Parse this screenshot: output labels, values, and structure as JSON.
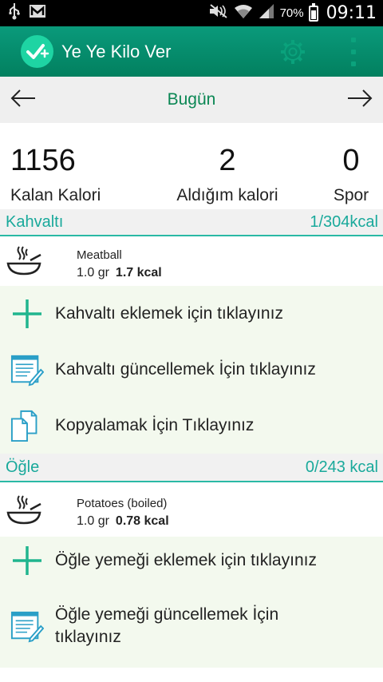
{
  "status_bar": {
    "battery_percent": "70%",
    "time": "09:11"
  },
  "app_bar": {
    "title": "Ye Ye Kilo Ver"
  },
  "date_nav": {
    "title": "Bugün"
  },
  "summary": {
    "remaining": {
      "value": "1156",
      "label": "Kalan Kalori"
    },
    "consumed": {
      "value": "2",
      "label": "Aldığım kalori"
    },
    "sport": {
      "value": "0",
      "label": "Spor"
    }
  },
  "meals": [
    {
      "name": "Kahvaltı",
      "calories": "1/304kcal",
      "food": {
        "name": "Meatball",
        "amount": "1.0 gr",
        "kcal": "1.7 kcal"
      },
      "add_label": "Kahvaltı eklemek için tıklayınız",
      "update_label": "Kahvaltı güncellemek İçin tıklayınız",
      "copy_label": "Kopyalamak İçin Tıklayınız"
    },
    {
      "name": "Öğle",
      "calories": "0/243 kcal",
      "food": {
        "name": "Potatoes (boiled)",
        "amount": "1.0 gr",
        "kcal": "0.78 kcal"
      },
      "add_label": "Öğle yemeği eklemek için tıklayınız",
      "update_label_line1": "Öğle yemeği güncellemek İçin",
      "update_label_line2": "tıklayınız"
    }
  ],
  "colors": {
    "app_bar": "#02805f",
    "accent": "#19a99b",
    "date_title": "#0b8754",
    "action_bg": "#f3f9ee"
  },
  "icons": [
    "usb-icon",
    "mail-icon",
    "mute-icon",
    "wifi-icon",
    "signal-icon",
    "battery-icon",
    "logo-icon",
    "settings-icon",
    "overflow-menu-icon",
    "arrow-left-icon",
    "arrow-right-icon",
    "bowl-icon",
    "plus-icon",
    "edit-list-icon",
    "copy-icon"
  ]
}
